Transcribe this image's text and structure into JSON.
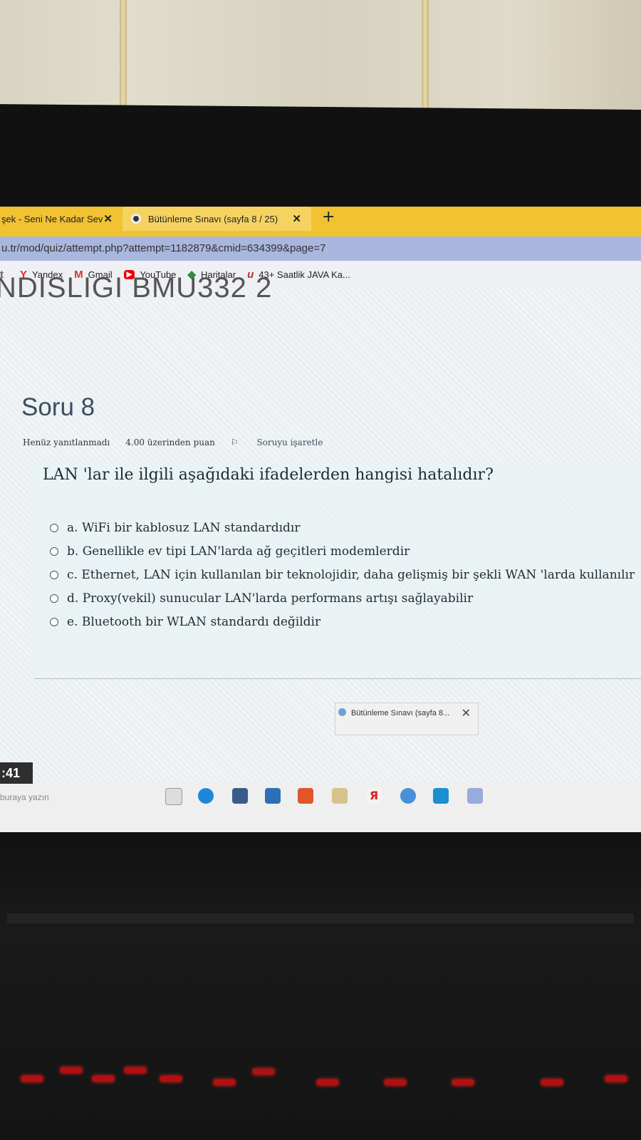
{
  "browser": {
    "tabs": [
      {
        "title": "şek - Seni Ne Kadar Sev",
        "close": "✕"
      },
      {
        "title": "Bütünleme Sınavı (sayfa 8 / 25)",
        "close": "✕"
      }
    ],
    "new_tab": "+",
    "url": "u.tr/mod/quiz/attempt.php?attempt=1182879&cmid=634399&page=7",
    "bookmarks": [
      {
        "label": "Yandex",
        "icon": "yandex-icon"
      },
      {
        "label": "Gmail",
        "icon": "gmail-icon"
      },
      {
        "label": "YouTube",
        "icon": "youtube-icon"
      },
      {
        "label": "Haritalar",
        "icon": "maps-icon"
      },
      {
        "label": "43+ Saatlik JAVA Ka...",
        "icon": "udemy-icon"
      }
    ]
  },
  "page": {
    "course_title": "NDISLIGI BMU332 2",
    "question_number": "Soru 8",
    "status": "Henüz yanıtlanmadı",
    "points": "4.00 üzerinden puan",
    "flag": "Soruyu işaretle",
    "question": "LAN 'lar ile ilgili aşağıdaki ifadelerden hangisi hatalıdır?",
    "answers": [
      "a. WiFi bir kablosuz LAN standardıdır",
      "b. Genellikle ev tipi LAN'larda ağ geçitleri modemlerdir",
      "c. Ethernet, LAN için kullanılan bir teknolojidir, daha gelişmiş bir şekli WAN 'larda kullanılır",
      "d. Proxy(vekil) sunucular LAN'larda performans artışı sağlayabilir",
      "e. Bluetooth bir WLAN standardı değildir"
    ]
  },
  "taskbar": {
    "clock": ":41",
    "search_placeholder": "buraya yazın",
    "preview_title": "Bütünleme Sınavı (sayfa 8...",
    "preview_close": "✕"
  }
}
